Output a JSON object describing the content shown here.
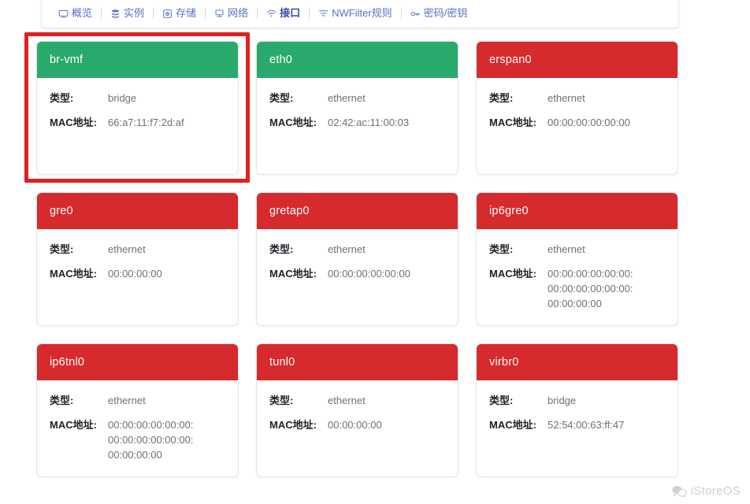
{
  "nav": {
    "items": [
      {
        "label": "概览",
        "icon": "monitor-icon",
        "active": false
      },
      {
        "label": "实例",
        "icon": "database-icon",
        "active": false
      },
      {
        "label": "存储",
        "icon": "disk-icon",
        "active": false
      },
      {
        "label": "网络",
        "icon": "network-icon",
        "active": false
      },
      {
        "label": "接口",
        "icon": "wifi-icon",
        "active": true
      },
      {
        "label": "NWFilter规则",
        "icon": "filter-icon",
        "active": false
      },
      {
        "label": "密码/密钥",
        "icon": "key-icon",
        "active": false
      }
    ]
  },
  "labels": {
    "type": "类型:",
    "mac": "MAC地址:"
  },
  "colors": {
    "green_header": "#2aa96c",
    "red_header": "#d62a2d",
    "annotation": "#e02020",
    "nav_link": "#5b6fc4"
  },
  "cards": [
    {
      "name": "br-vmf",
      "status": "green",
      "type": "bridge",
      "mac": [
        "66:a7:11:f7:2d:af"
      ]
    },
    {
      "name": "eth0",
      "status": "green",
      "type": "ethernet",
      "mac": [
        "02:42:ac:11:00:03"
      ]
    },
    {
      "name": "erspan0",
      "status": "red",
      "type": "ethernet",
      "mac": [
        "00:00:00:00:00:00"
      ]
    },
    {
      "name": "gre0",
      "status": "red",
      "type": "ethernet",
      "mac": [
        "00:00:00:00"
      ]
    },
    {
      "name": "gretap0",
      "status": "red",
      "type": "ethernet",
      "mac": [
        "00:00:00:00:00:00"
      ]
    },
    {
      "name": "ip6gre0",
      "status": "red",
      "type": "ethernet",
      "mac": [
        "00:00:00:00:00:00:",
        "00:00:00:00:00:00:",
        "00:00:00:00"
      ]
    },
    {
      "name": "ip6tnl0",
      "status": "red",
      "type": "ethernet",
      "mac": [
        "00:00:00:00:00:00:",
        "00:00:00:00:00:00:",
        "00:00:00:00"
      ]
    },
    {
      "name": "tunl0",
      "status": "red",
      "type": "ethernet",
      "mac": [
        "00:00:00:00"
      ]
    },
    {
      "name": "virbr0",
      "status": "red",
      "type": "bridge",
      "mac": [
        "52:54:00:63:ff:47"
      ]
    }
  ],
  "annotation": {
    "target": "br-vmf"
  },
  "watermark": {
    "text": "iStoreOS",
    "icon": "wechat-icon"
  }
}
